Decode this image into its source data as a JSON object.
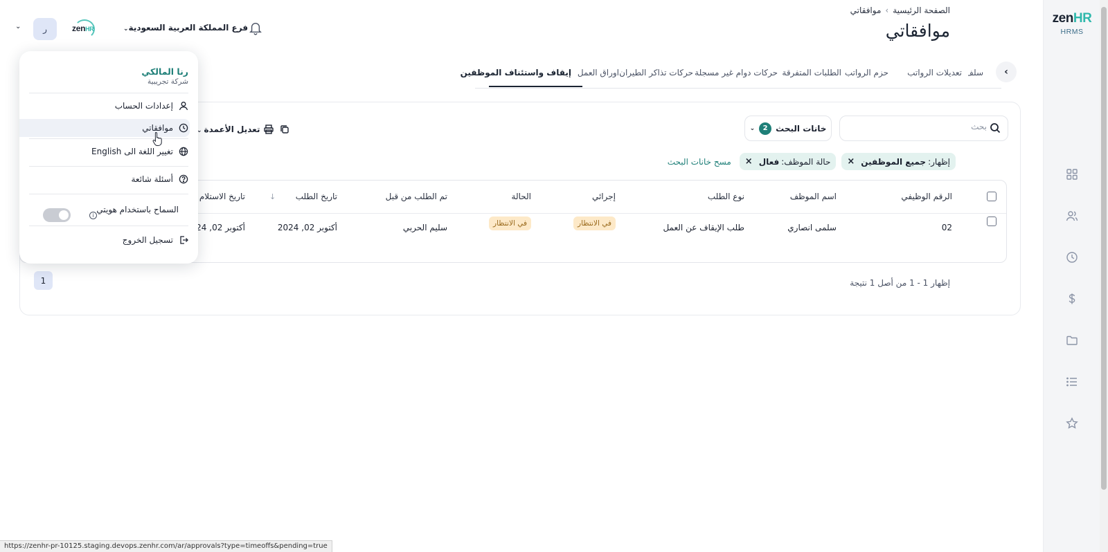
{
  "header": {
    "breadcrumb_home": "الصفحة الرئيسية",
    "breadcrumb_current": "موافقاتي",
    "page_title": "موافقاتي",
    "branch": "فرع المملكة العربية السعودية",
    "avatar_initial": "ر",
    "brand_small": "zen",
    "brand_small_accent": "HR"
  },
  "rail": {
    "logo_main": "zen",
    "logo_accent": "HR",
    "logo_sub": "HRMS",
    "icons": [
      "grid-icon",
      "users-icon",
      "clock-icon",
      "dollar-icon",
      "folder-icon",
      "list-icon",
      "star-icon"
    ]
  },
  "tabs": [
    {
      "label": "إيقاف واستئناف الموظفين",
      "active": true
    },
    {
      "label": "اوراق العمل"
    },
    {
      "label": "حركات تذاكر الطيران"
    },
    {
      "label": "حركات دوام غير مسجلة"
    },
    {
      "label": "الطلبات المتفرقة"
    },
    {
      "label": "حزم الرواتب"
    },
    {
      "label": "تعديلات الرواتب"
    },
    {
      "label": "سلف"
    }
  ],
  "toolbar": {
    "search_placeholder": "بحث",
    "filters_label": "خانات البحث",
    "filters_count": "2",
    "columns_label": "تعديل الأعمدة"
  },
  "chips": [
    {
      "prefix": "إظهار:",
      "value": "جميع الموظفين"
    },
    {
      "prefix": "حالة الموظف:",
      "value": "فعال"
    }
  ],
  "clear_filters": "مسح خانات البحث",
  "table": {
    "columns": [
      "الرقم الوظيفي",
      "اسم الموظف",
      "نوع الطلب",
      "إجرائي",
      "الحالة",
      "تم الطلب من قبل",
      "تاريخ الطلب",
      "تاريخ الاستلام"
    ],
    "rows": [
      {
        "id": "02",
        "employee": "سلمى انصاري",
        "type": "طلب الإيقاف عن العمل",
        "action": "في الانتظار",
        "status": "في الانتظار",
        "requested_by": "سليم الحربي",
        "request_date": "أكتوبر 02, 2024",
        "received_date": "أكتوبر 02, 2024"
      }
    ]
  },
  "pagination": {
    "summary": "إظهار 1 - 1 من أصل 1 نتيجة",
    "current_page": "1"
  },
  "user_menu": {
    "name": "رنا المالكي",
    "company": "شركة تجريبية",
    "items": [
      {
        "label": "إعدادات الحساب",
        "icon": "user-icon"
      },
      {
        "label": "موافقاتي",
        "icon": "clock-icon"
      },
      {
        "label": "تغيير اللغة الى English",
        "icon": "globe-icon"
      },
      {
        "label": "أسئلة شائعة",
        "icon": "help-icon"
      },
      {
        "label": "السماح باستخدام هويتي",
        "icon": "info-icon"
      },
      {
        "label": "تسجيل الخروج",
        "icon": "logout-icon"
      }
    ]
  },
  "status_url": "https://zenhr-pr-10125.staging.devops.zenhr.com/ar/approvals?type=timeoffs&pending=true",
  "colors": {
    "accent": "#1e7f78",
    "brand": "#2fb8ac",
    "badge_bg": "#fde9c8",
    "chip_bg": "#e3f2ef"
  }
}
